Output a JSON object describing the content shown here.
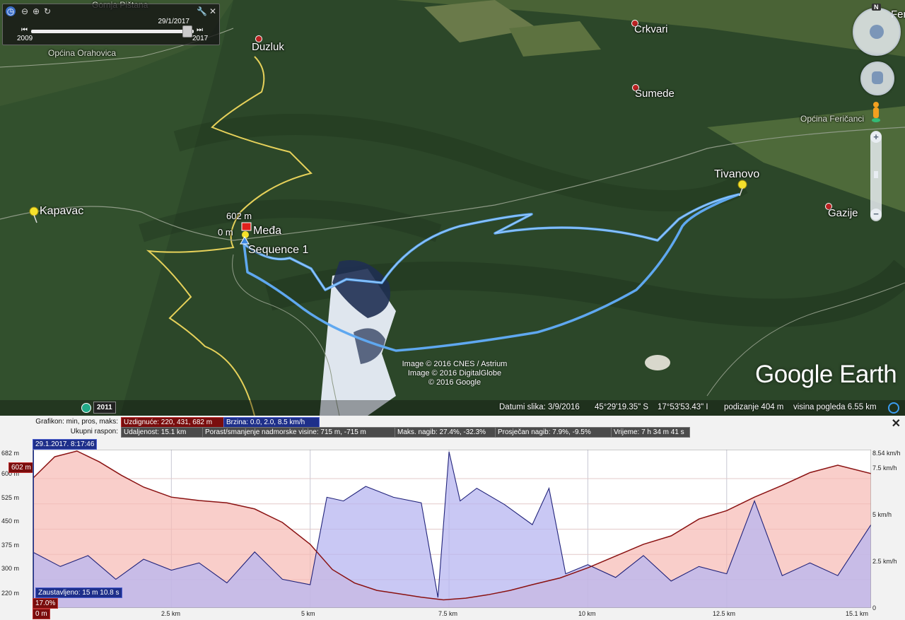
{
  "time_slider": {
    "date": "29/1/2017",
    "start_year": "2009",
    "end_year": "2017"
  },
  "places": {
    "gornja_pistana": "Gornja Pištana",
    "opcina_orahovica": "Općina Orahovica",
    "duzluk": "Duzluk",
    "crkvari": "Crkvari",
    "sumede": "Sumede",
    "opcina_fericanci": "Općina Feričanci",
    "fer": "Fer",
    "tivanovo": "Tivanovo",
    "gazije": "Gazije",
    "kapavac": "Kapavac"
  },
  "track": {
    "start_elev": "602 m",
    "zero_elev": "0 m",
    "start_name": "Međa",
    "sequence_name": "Sequence 1"
  },
  "credits": [
    "Image © 2016 CNES / Astrium",
    "Image © 2016 DigitalGlobe",
    "© 2016 Google"
  ],
  "brand": "Google Earth",
  "historical_year": "2011",
  "status": {
    "date": "Datumi slika: 3/9/2016",
    "lat": "45°29'19.35\" S",
    "lon": "17°53'53.43\" I",
    "elev": "podizanje   404 m",
    "eye": "visina pogleda    6.55 km"
  },
  "profile": {
    "graph_label": "Grafikon: min, pros, maks:",
    "elevation_tag": "Uzdignuće: 220, 431, 682 m",
    "speed_tag": "Brzina: 0.0, 2.0, 8.5 km/h",
    "range_label": "Ukupni raspon:",
    "distance": "Udaljenost: 15.1 km",
    "gain_loss": "Porast/smanjenje nadmorske visine: 715 m, -715 m",
    "max_slope": "Maks. nagib: 27.4%, -32.3%",
    "avg_slope": "Prosječan nagib: 7.9%, -9.5%",
    "time": "Vrijeme: 7 h 34 m 41 s",
    "cursor_time": "29.1.2017. 8:17:46",
    "cursor_elev": "602 m",
    "stopped": "Zaustavljeno: 15 m 10.8 s",
    "slope_tag": "17.0%",
    "dist_tag": "0 m",
    "y_left": [
      "682 m",
      "600 m",
      "525 m",
      "450 m",
      "375 m",
      "300 m",
      "220 m"
    ],
    "y_right": [
      "8.54 km/h",
      "7.5 km/h",
      "5 km/h",
      "2.5 km/h",
      "0"
    ],
    "x_ticks": [
      "2.5 km",
      "5 km",
      "7.5 km",
      "10 km",
      "12.5 km",
      "15.1 km"
    ]
  },
  "chart_data": {
    "type": "area",
    "xlabel": "",
    "ylabel": "",
    "xlim": [
      0,
      15.1
    ],
    "ylim_elevation": [
      220,
      682
    ],
    "ylim_speed": [
      0,
      8.54
    ],
    "series": [
      {
        "name": "Uzdignuće",
        "x": [
          0,
          0.4,
          0.8,
          1.2,
          1.6,
          2.0,
          2.5,
          3.0,
          3.5,
          4.0,
          4.5,
          5.0,
          5.4,
          5.8,
          6.2,
          6.6,
          7.0,
          7.4,
          7.8,
          8.2,
          8.6,
          9.0,
          9.5,
          10.0,
          10.5,
          11.0,
          11.5,
          12.0,
          12.5,
          13.0,
          13.5,
          14.0,
          14.5,
          15.1
        ],
        "values": [
          600,
          665,
          682,
          650,
          610,
          575,
          545,
          535,
          528,
          510,
          470,
          405,
          330,
          290,
          268,
          258,
          248,
          240,
          245,
          255,
          268,
          285,
          305,
          335,
          370,
          405,
          430,
          480,
          505,
          545,
          580,
          618,
          640,
          615
        ]
      },
      {
        "name": "Brzina",
        "x": [
          0,
          0.5,
          1.0,
          1.5,
          2.0,
          2.5,
          3.0,
          3.5,
          4.0,
          4.5,
          5.0,
          5.3,
          5.6,
          6.0,
          6.5,
          7.0,
          7.3,
          7.5,
          7.7,
          8.0,
          8.5,
          9.0,
          9.3,
          9.6,
          10.0,
          10.5,
          11.0,
          11.5,
          12.0,
          12.5,
          13.0,
          13.5,
          14.0,
          14.5,
          15.1
        ],
        "values": [
          3.0,
          2.2,
          2.8,
          1.5,
          2.6,
          2.0,
          2.4,
          1.3,
          3.0,
          1.5,
          1.2,
          6.0,
          5.8,
          6.6,
          6.0,
          5.7,
          0.5,
          8.5,
          5.8,
          6.5,
          5.6,
          4.5,
          6.5,
          1.8,
          2.3,
          1.6,
          2.8,
          1.4,
          2.2,
          1.8,
          5.8,
          1.7,
          2.4,
          1.7,
          4.5
        ]
      }
    ]
  }
}
